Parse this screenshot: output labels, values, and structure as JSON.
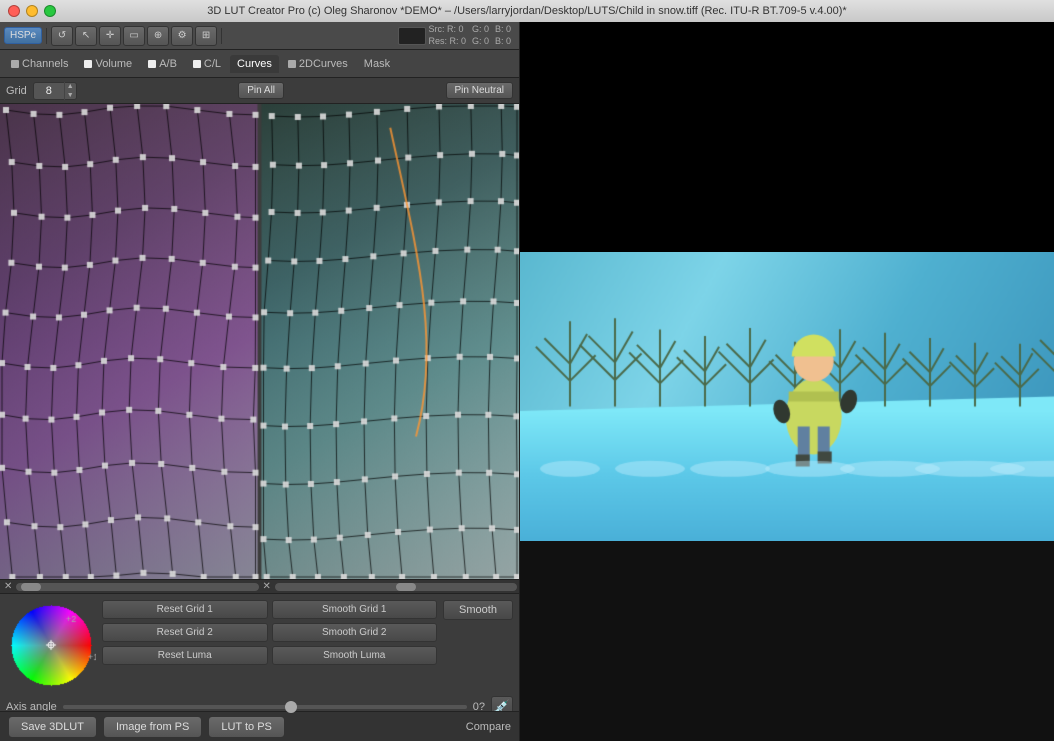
{
  "titlebar": {
    "text": "3D LUT Creator Pro (c) Oleg Sharonov *DEMO* – /Users/larryjordan/Desktop/LUTS/Child in snow.tiff (Rec. ITU-R BT.709-5 v.4.00)*"
  },
  "toolbar": {
    "mode_label": "HSPe",
    "src_label": "Src:",
    "res_label": "Res:",
    "r_src": "R:  0",
    "g_src": "G:  0",
    "b_src": "B:  0",
    "r_res": "R:  0",
    "g_res": "G:  0",
    "b_res": "B:  0"
  },
  "tabs": {
    "channels": "Channels",
    "volume": "Volume",
    "ab": "A/B",
    "cl": "C/L",
    "curves": "Curves",
    "curves2d": "2DCurves",
    "mask": "Mask"
  },
  "grid_controls": {
    "label": "Grid",
    "value": "8",
    "pin_all": "Pin All",
    "pin_neutral": "Pin Neutral"
  },
  "bottom_controls": {
    "reset_grid_1": "Reset Grid 1",
    "smooth_grid_1": "Smooth Grid 1",
    "reset_grid_2": "Reset Grid 2",
    "smooth_grid_2": "Smooth Grid 2",
    "reset_luma": "Reset Luma",
    "smooth_luma": "Smooth Luma",
    "smooth": "Smooth",
    "axis_angle_label": "Axis angle",
    "axis_value": "0?"
  },
  "bottom_bar": {
    "save_3dlut": "Save 3DLUT",
    "image_from_ps": "Image from PS",
    "lut_to_ps": "LUT to PS",
    "compare": "Compare"
  }
}
